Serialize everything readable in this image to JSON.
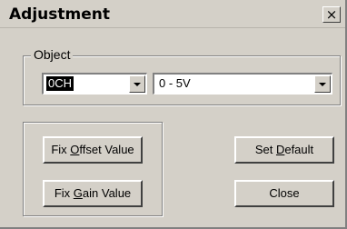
{
  "window": {
    "title": "Adjustment",
    "close_glyph": "×"
  },
  "object_group": {
    "label": "Object",
    "channel_select": {
      "value": "0CH"
    },
    "range_select": {
      "value": "0 - 5V"
    }
  },
  "buttons": {
    "fix_offset": {
      "pre": "Fix ",
      "accel": "O",
      "post": "ffset Value"
    },
    "fix_gain": {
      "pre": "Fix ",
      "accel": "G",
      "post": "ain Value"
    },
    "set_default": {
      "pre": "Set ",
      "accel": "D",
      "post": "efault"
    },
    "close": {
      "label": "Close"
    }
  },
  "colors": {
    "face": "#d4d0c8",
    "shadow": "#808080",
    "highlight": "#ffffff"
  },
  "icons": {
    "combo_arrow": "chevron-down-icon",
    "close": "close-icon"
  }
}
